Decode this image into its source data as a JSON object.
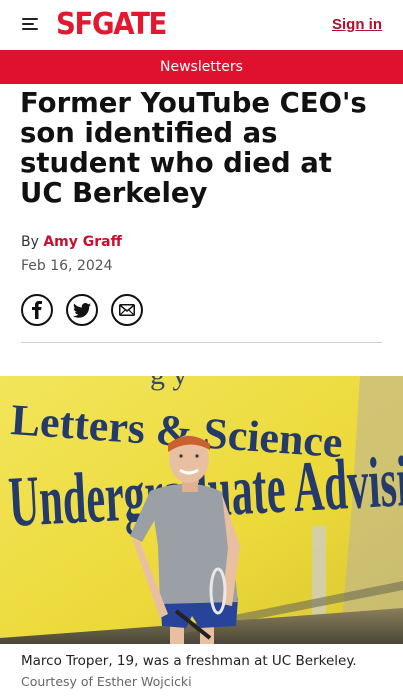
{
  "header": {
    "logo_text": "SFGATE",
    "signin_label": "Sign in",
    "menu_icon": "hamburger-menu-icon"
  },
  "newsletters": {
    "label": "Newsletters"
  },
  "article": {
    "headline_lines": [
      "Former YouTube CEO's",
      "son identified as",
      "student who died at",
      "UC Berkeley"
    ],
    "byline_prefix": "By",
    "author": "Amy Graff",
    "date": "Feb 16, 2024"
  },
  "share": [
    {
      "icon": "facebook-icon"
    },
    {
      "icon": "twitter-icon"
    },
    {
      "icon": "email-icon"
    }
  ],
  "photo": {
    "sign_line_1": "Letters & Science",
    "sign_line_2": "Undergraduate Advisi",
    "caption": "Marco Troper, 19, was a freshman at UC Berkeley.",
    "credit": "Courtesy of Esther Wojcicki"
  },
  "colors": {
    "brand_red": "#e3172d",
    "signin_red": "#b0102a",
    "newsletter_bar": "#e0102f",
    "wall_yellow": "#efe14a",
    "sign_navy": "#233a6b"
  }
}
